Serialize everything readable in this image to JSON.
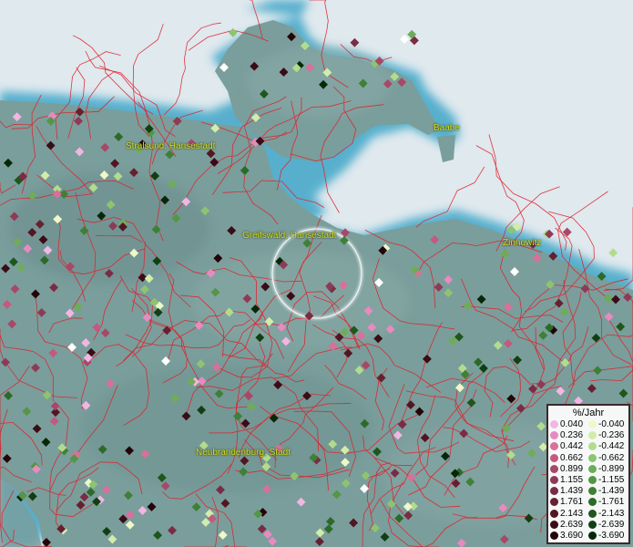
{
  "map": {
    "cities": [
      {
        "name": "Stralsund, Hansestadt"
      },
      {
        "name": "Baabe"
      },
      {
        "name": "Greifswald, Hansestadt"
      },
      {
        "name": "Zinnowitz"
      },
      {
        "name": "Neubrandenburg, Stadt"
      }
    ],
    "colors": {
      "sea": "#dfe9ee",
      "land": "#7a9e9c",
      "coast_shallow": "#3fa6c8",
      "borders": "#e0202a",
      "label": "#d8e020",
      "highlight_ring": "#ffffff"
    }
  },
  "legend": {
    "title": "%/Jahr",
    "positive": [
      {
        "label": "0.040",
        "color": "#f2b6e2"
      },
      {
        "label": "0.236",
        "color": "#e88ac0"
      },
      {
        "label": "0.442",
        "color": "#d8709a"
      },
      {
        "label": "0.662",
        "color": "#c25a80"
      },
      {
        "label": "0.899",
        "color": "#a84868"
      },
      {
        "label": "1.155",
        "color": "#8e3a56"
      },
      {
        "label": "1.439",
        "color": "#7a2c44"
      },
      {
        "label": "1.761",
        "color": "#662030"
      },
      {
        "label": "2.143",
        "color": "#521622"
      },
      {
        "label": "2.639",
        "color": "#3a0c16"
      },
      {
        "label": "3.690",
        "color": "#240408"
      }
    ],
    "negative": [
      {
        "label": "-0.040",
        "color": "#eef8c8"
      },
      {
        "label": "-0.236",
        "color": "#d2ecaa"
      },
      {
        "label": "-0.442",
        "color": "#b2dc8c"
      },
      {
        "label": "-0.662",
        "color": "#8ec470"
      },
      {
        "label": "-0.899",
        "color": "#6eac58"
      },
      {
        "label": "-1.155",
        "color": "#549646"
      },
      {
        "label": "-1.439",
        "color": "#3e8036"
      },
      {
        "label": "-1.761",
        "color": "#2c6a28"
      },
      {
        "label": "-2.143",
        "color": "#1e561c"
      },
      {
        "label": "-2.639",
        "color": "#104012"
      },
      {
        "label": "-3.690",
        "color": "#062808"
      }
    ]
  }
}
